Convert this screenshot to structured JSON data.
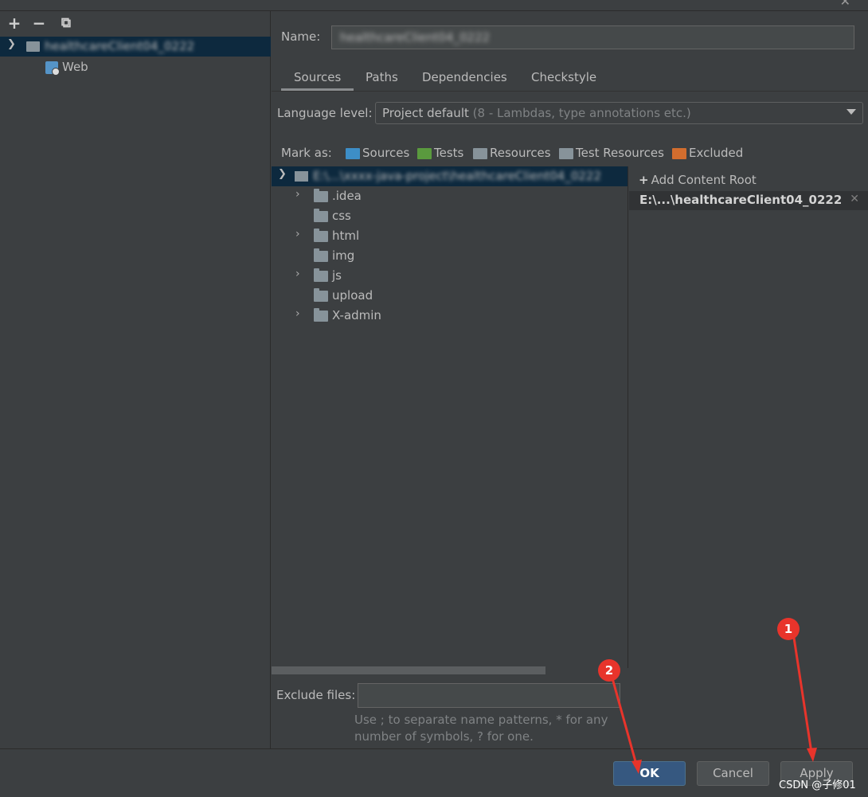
{
  "window": {
    "close_icon": "✕"
  },
  "left_panel": {
    "toolbar": {
      "add": "+",
      "remove": "−",
      "copy": "⧉"
    },
    "module_name": "healthcareClient04_0222",
    "facet": "Web"
  },
  "name": {
    "label": "Name:",
    "value": "healthcareClient04_0222"
  },
  "tabs": [
    "Sources",
    "Paths",
    "Dependencies",
    "Checkstyle"
  ],
  "language": {
    "label": "Language level:",
    "value": "Project default",
    "hint": "(8 - Lambdas, type annotations etc.)"
  },
  "mark_as": {
    "label": "Mark as:",
    "items": [
      {
        "label": "Sources",
        "color": "#3d8ec7"
      },
      {
        "label": "Tests",
        "color": "#5a9a3e"
      },
      {
        "label": "Resources",
        "color": "#87939a"
      },
      {
        "label": "Test Resources",
        "color": "#87939a"
      },
      {
        "label": "Excluded",
        "color": "#d26d2e"
      }
    ]
  },
  "tree": {
    "root_path": "E:\\...\\xxxx-java-project\\healthcareClient04_0222",
    "items": [
      {
        "label": ".idea",
        "expandable": true
      },
      {
        "label": "css",
        "expandable": false
      },
      {
        "label": "html",
        "expandable": true
      },
      {
        "label": "img",
        "expandable": false
      },
      {
        "label": "js",
        "expandable": true
      },
      {
        "label": "upload",
        "expandable": false
      },
      {
        "label": "X-admin",
        "expandable": true
      }
    ]
  },
  "content_roots": {
    "add_label": "Add Content Root",
    "entry": "E:\\...\\healthcareClient04_0222",
    "remove_icon": "✕"
  },
  "exclude": {
    "label": "Exclude files:",
    "value": "",
    "help": "Use ; to separate name patterns, * for any number of symbols, ? for one."
  },
  "buttons": {
    "ok": "OK",
    "cancel": "Cancel",
    "apply": "Apply"
  },
  "annotations": {
    "badge1": "1",
    "badge2": "2",
    "accent": "#e8342b"
  },
  "watermark": "CSDN @子修01"
}
